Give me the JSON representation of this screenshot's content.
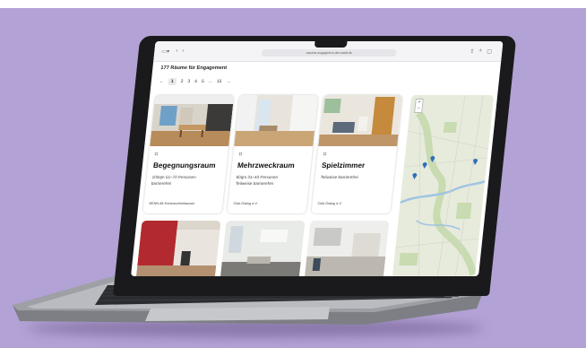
{
  "browser": {
    "url": "raeume.engagiert-in-der-stadt.de",
    "icons": {
      "sidebar": "sidebar-icon",
      "back": "back-arrow-icon",
      "forward": "forward-arrow-icon",
      "share": "share-icon",
      "new_tab": "plus-icon",
      "tabs": "tabs-icon"
    }
  },
  "page": {
    "title": "177 Räume für Engagement",
    "pagination": {
      "prev": "←",
      "pages": [
        "1",
        "2",
        "3",
        "4",
        "5",
        "...",
        "15"
      ],
      "current": "1",
      "next": "→"
    }
  },
  "cards": [
    {
      "title": "Begegnungsraum",
      "meta_line1": "100qm   51–70 Personen",
      "meta_line2": "barrierefrei",
      "org": "BENN Alt-Hohenschönhausen",
      "icon": "room-frame-icon"
    },
    {
      "title": "Mehrzweckraum",
      "meta_line1": "60qm   31–40 Personen",
      "meta_line2": "Teilweise barrierefrei",
      "org": "Club Dialog e.V.",
      "icon": "room-frame-icon"
    },
    {
      "title": "Spielzimmer",
      "meta_line1": "Teilweise barrierefrei",
      "meta_line2": "",
      "org": "Club Dialog e.V.",
      "icon": "room-frame-icon"
    }
  ],
  "map": {
    "zoom_in": "+",
    "zoom_out": "−",
    "pin_color": "#2f6fb8",
    "pin_icon": "map-pin-icon"
  },
  "colors": {
    "background": "#b3a2d5",
    "laptop": "#1a1a1c",
    "map_green": "#c9dbb0",
    "water": "#9ec4e2"
  }
}
